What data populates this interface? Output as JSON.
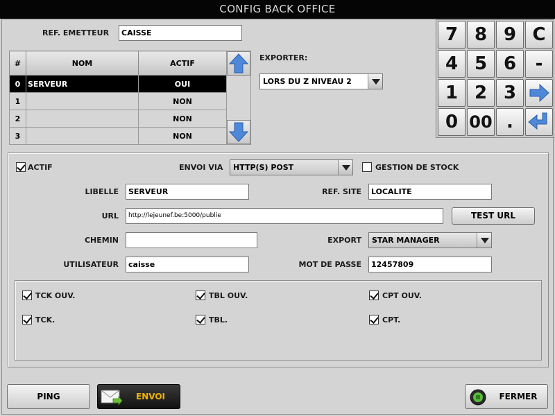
{
  "window": {
    "title": "CONFIG BACK OFFICE"
  },
  "emitter": {
    "label": "REF. EMETTEUR",
    "value": "CAISSE"
  },
  "table": {
    "headers": [
      "#",
      "NOM",
      "ACTIF"
    ],
    "rows": [
      {
        "idx": "0",
        "name": "SERVEUR",
        "active": "OUI",
        "selected": true
      },
      {
        "idx": "1",
        "name": "",
        "active": "NON"
      },
      {
        "idx": "2",
        "name": "",
        "active": "NON"
      },
      {
        "idx": "3",
        "name": "",
        "active": "NON"
      }
    ]
  },
  "exporter": {
    "label": "EXPORTER:",
    "value": "LORS DU Z NIVEAU 2"
  },
  "keypad": {
    "keys": [
      "7",
      "8",
      "9",
      "C",
      "4",
      "5",
      "6",
      "-",
      "1",
      "2",
      "3",
      "",
      "0",
      "00",
      ".",
      ""
    ]
  },
  "form": {
    "actif_label": "ACTIF",
    "envoi_via_label": "ENVOI VIA",
    "envoi_via_value": "HTTP(S) POST",
    "gestion_stock_label": "GESTION DE STOCK",
    "libelle_label": "LIBELLE",
    "libelle_value": "SERVEUR",
    "ref_site_label": "REF. SITE",
    "ref_site_value": "LOCALITE",
    "url_label": "URL",
    "url_value": "http://lejeunef.be:5000/publie",
    "test_url_label": "TEST URL",
    "chemin_label": "CHEMIN",
    "chemin_value": "",
    "export_label": "EXPORT",
    "export_value": "STAR MANAGER",
    "user_label": "UTILISATEUR",
    "user_value": "caisse",
    "password_label": "MOT DE PASSE",
    "password_value": "12457809"
  },
  "options": {
    "tck_ouv": "TCK OUV.",
    "tbl_ouv": "TBL OUV.",
    "cpt_ouv": "CPT OUV.",
    "tck": "TCK.",
    "tbl": "TBL.",
    "cpt": "CPT."
  },
  "footer": {
    "ping": "PING",
    "envoi": "ENVOI",
    "fermer": "FERMER"
  },
  "colors": {
    "titlebar": "#050505",
    "envoi_text": "#f0b400",
    "arrow_blue": "#4f88d8"
  }
}
